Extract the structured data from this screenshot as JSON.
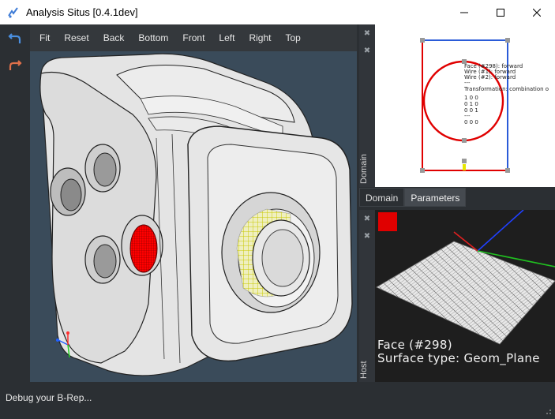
{
  "window": {
    "title": "Analysis Situs [0.4.1dev]",
    "icon": "app-logo-icon",
    "controls": [
      "minimize-icon",
      "maximize-icon",
      "close-icon"
    ]
  },
  "toolbar": {
    "buttons": [
      "Fit",
      "Reset",
      "Back",
      "Bottom",
      "Front",
      "Left",
      "Right",
      "Top"
    ]
  },
  "left_tools": [
    "undo-icon",
    "redo-icon"
  ],
  "viewer": {
    "highlight_color": "#ff0000",
    "selection_color": "#e6e600",
    "background": "#3a4b5a",
    "triad_axes": [
      "x-axis",
      "y-axis",
      "z-axis"
    ]
  },
  "domain_panel": {
    "label": "Domain",
    "info_lines": [
      "Face (#298): forward",
      "Wire (#1): forward",
      "Wire (#2): forward",
      "---",
      "Transformation: combination o",
      "1 0 0",
      "0 1 0",
      "0 0 1",
      "---",
      "0 0 0"
    ]
  },
  "tabs": [
    {
      "label": "Domain",
      "active": false
    },
    {
      "label": "Parameters",
      "active": true
    }
  ],
  "host_panel": {
    "label": "Host",
    "swatch_color": "#e00000",
    "face_label": "Face (#298)",
    "surface_label": "Surface type: Geom_Plane"
  },
  "status": {
    "message": "Debug your B-Rep..."
  }
}
